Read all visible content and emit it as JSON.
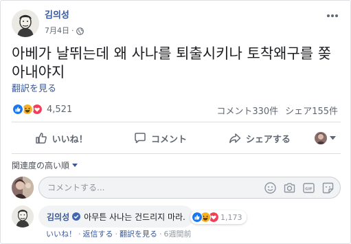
{
  "post": {
    "author": "김의성",
    "date": "7月4日",
    "dot": "·",
    "text": "아베가 날뛰는데 왜 사나를 퇴출시키나 토착왜구를 쫒아내야지",
    "see_translation": "翻訳を見る",
    "reaction_count": "4,521",
    "comments_count": "コメント330件",
    "shares_count": "シェア155件",
    "icons": [
      "globe-icon",
      "more-icon",
      "like-reaction-icon",
      "haha-reaction-icon",
      "love-reaction-icon"
    ]
  },
  "actions": {
    "like": "いいね！",
    "comment": "コメント",
    "share": "シェアする",
    "icons": [
      "thumbs-up-icon",
      "speech-bubble-icon",
      "share-arrow-icon",
      "caret-down-icon"
    ]
  },
  "comments": {
    "sort_label": "関連度の高い順",
    "input_placeholder": "コメントする...",
    "input_icons": [
      "emoji-icon",
      "camera-icon",
      "gif-icon",
      "sticker-icon"
    ],
    "items": [
      {
        "author": "김의성",
        "text": "아무튼 사나는 건드리지 마라.",
        "reaction_count": "1,173",
        "like": "いいね！",
        "reply": "返信する",
        "see_translation": "翻訳を見る",
        "time": "6週間前",
        "dot": "·"
      }
    ]
  },
  "colors": {
    "link_blue": "#385898",
    "like_blue": "#1877f2",
    "love_red": "#f33e58",
    "haha_yellow": "#f7b125",
    "verified_blue": "#4267b2"
  }
}
